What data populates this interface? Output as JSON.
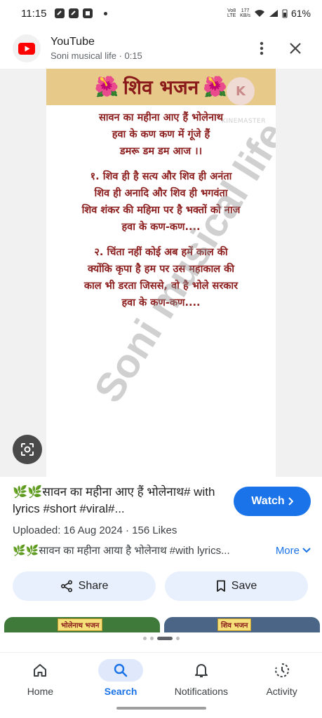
{
  "status": {
    "time": "11:15",
    "network": "Vo8 LTE",
    "speed_value": "177",
    "speed_unit": "KB/s",
    "battery": "61%"
  },
  "header": {
    "app_name": "YouTube",
    "subtitle": "Soni musical life · 0:15"
  },
  "video": {
    "banner_title": "शिव भजन",
    "km_badge": "K",
    "km_text": "KINEMASTER",
    "watermark": "Soni musical life",
    "stanzas": [
      [
        "सावन का महीना आए हैं भोलेनाथ",
        "हवा के कण कण में गूंजे हैं",
        "डमरू डम डम आज ।।"
      ],
      [
        "१. शिव ही है सत्य और शिव ही अनंता",
        "शिव ही अनादि और शिव ही भगवंता",
        "शिव शंकर की महिमा पर है भक्तों को नाज",
        "हवा के कण-कण...."
      ],
      [
        "२. चिंता नहीं कोई अब हमें  काल की",
        "क्योंकि कृपा है हम पर उस महाकाल की",
        "काल भी डरता जिससे, वो है भोले सरकार",
        "हवा के कण-कण...."
      ]
    ]
  },
  "info": {
    "title": "🌿🌿सावन का महीना आए हैं भोलेनाथ# with lyrics #short #viral#...",
    "watch_label": "Watch",
    "meta": "Uploaded: 16 Aug 2024  ·  156 Likes",
    "description": "🌿🌿सावन का महीना आया है भोलेनाथ #with lyrics...",
    "more_label": "More"
  },
  "actions": {
    "share_label": "Share",
    "save_label": "Save"
  },
  "related": {
    "thumb1_tag": "भोलेनाथ भजन",
    "thumb2_tag": "शिव भजन"
  },
  "nav": {
    "items": [
      {
        "label": "Home",
        "icon": "home-icon"
      },
      {
        "label": "Search",
        "icon": "search-icon"
      },
      {
        "label": "Notifications",
        "icon": "bell-icon"
      },
      {
        "label": "Activity",
        "icon": "activity-icon"
      }
    ],
    "active": "Search"
  },
  "colors": {
    "accent": "#1a73e8",
    "lyrics": "#8b1d1d",
    "banner": "#e7c98a"
  }
}
